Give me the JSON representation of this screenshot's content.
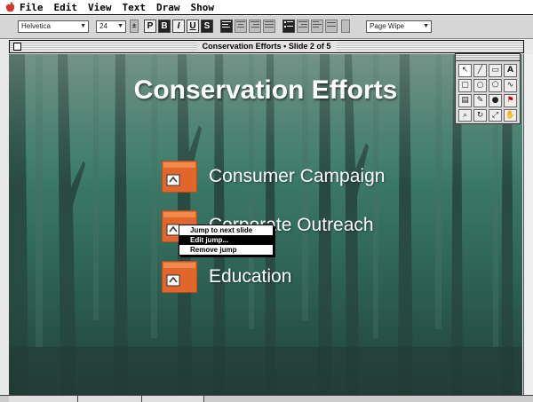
{
  "menubar": {
    "apple_icon": "apple-icon",
    "items": [
      "File",
      "Edit",
      "View",
      "Text",
      "Draw",
      "Show"
    ]
  },
  "toolbar": {
    "font": "Helvetica",
    "size": "24",
    "style_buttons": [
      "P",
      "B",
      "I",
      "U",
      "S"
    ],
    "transition": "Page Wipe"
  },
  "window": {
    "title": "Conservation Efforts • Slide 2 of 5"
  },
  "slide": {
    "title": "Conservation Efforts",
    "bullets": [
      {
        "label": "Consumer Campaign",
        "icon": "jump-link-icon"
      },
      {
        "label": "Corporate Outreach",
        "icon": "jump-link-icon"
      },
      {
        "label": "Education",
        "icon": "jump-link-icon"
      }
    ]
  },
  "context_menu": {
    "items": [
      "Jump to next slide",
      "Edit jump...",
      "Remove jump"
    ],
    "highlighted_index": 1
  },
  "tool_palette": {
    "tools": [
      "arrow-tool-icon",
      "line-tool-icon",
      "text-tool-icon",
      "rectangle-tool-icon",
      "rounded-rect-tool-icon",
      "oval-tool-icon",
      "polygon-tool-icon",
      "freehand-tool-icon",
      "fill-tool-icon",
      "pen-tool-icon",
      "zoom-tool-icon",
      "rotate-tool-icon"
    ]
  },
  "colors": {
    "bullet_orange": "#e0662c",
    "slide_text": "#ffffff",
    "forest_teal": "#2f6a5c"
  }
}
